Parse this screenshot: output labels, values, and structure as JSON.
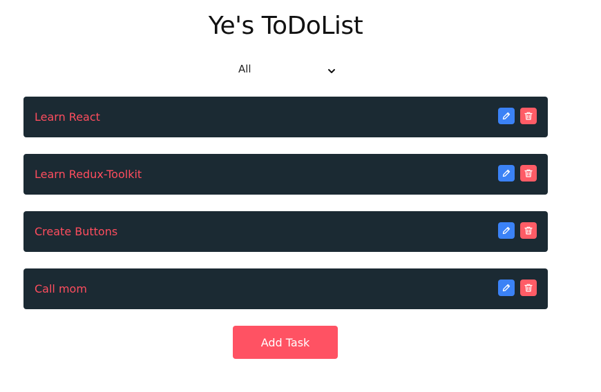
{
  "header": {
    "title": "Ye's ToDoList"
  },
  "filter": {
    "selected": "All"
  },
  "tasks": [
    {
      "label": "Learn React"
    },
    {
      "label": "Learn Redux-Toolkit"
    },
    {
      "label": "Create Buttons"
    },
    {
      "label": "Call mom"
    }
  ],
  "actions": {
    "add_label": "Add Task"
  },
  "colors": {
    "task_background": "#1b2a33",
    "task_text": "#ff4d5e",
    "edit_button": "#3b82f6",
    "delete_button": "#ff5c66",
    "add_button": "#ff5263"
  },
  "icons": {
    "edit": "pencil-icon",
    "delete": "trash-icon",
    "filter_caret": "chevron-down-icon"
  }
}
